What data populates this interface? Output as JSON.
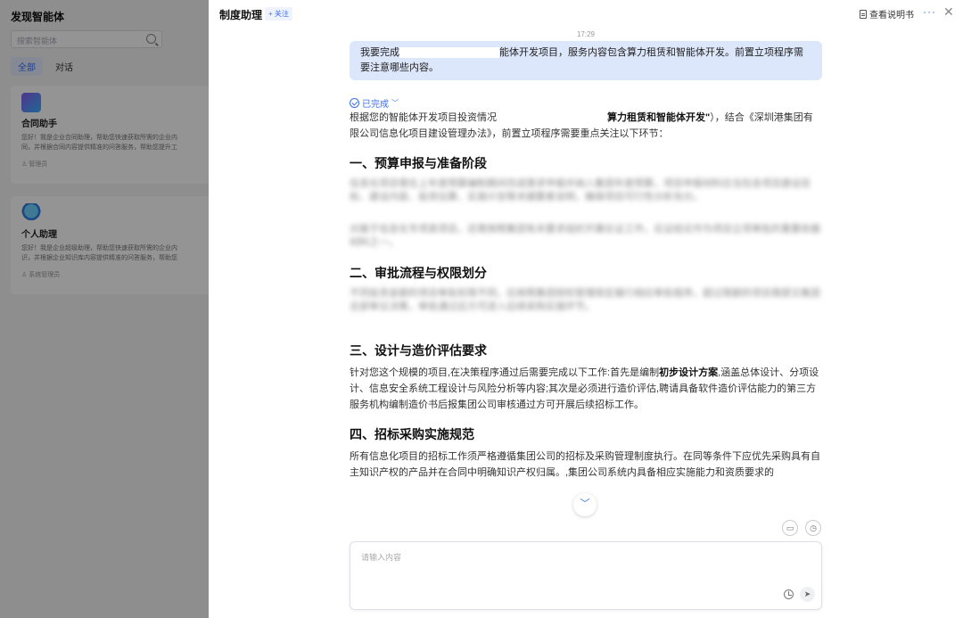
{
  "left_panel": {
    "title": "发现智能体",
    "search_placeholder": "搜索智能体",
    "tabs": [
      {
        "label": "全部",
        "active": true
      },
      {
        "label": "对话",
        "active": false
      }
    ],
    "cards": [
      {
        "name": "合同助手",
        "desc1": "您好！我是企业合同助理，帮助您快速获取所需的企业内",
        "desc2": "同，并根据合同内容提供精准的问答服务，帮助您提升工",
        "owner": "管理员"
      },
      {
        "name": "个人助理",
        "desc1": "您好！我是企业超级助理，帮助您快速获取所需的企业内",
        "desc2": "识，并根据企业知识库内容提供精准的问答服务，帮助您",
        "owner": "系统管理员"
      }
    ]
  },
  "header": {
    "title": "制度助理",
    "follow_label": "+ 关注",
    "manual_label": "查看说明书",
    "more_label": "···",
    "close_label": "✕"
  },
  "chat": {
    "timestamp": "17:29",
    "user_message_part1": "我要完成",
    "user_message_part2": "能体开发项目，服务内容包含算力租赁和智能体开发。前置立项程序需要注意哪些内容。",
    "status_label": "已完成",
    "answer_intro_part1": "根据您的智能体开发项目投资情况",
    "answer_intro_bold": "算力租赁和智能体开发\"",
    "answer_intro_part2": "），结合《深圳港集团有限公司信息化项目建设管理办法》，前置立项程序需要重点关注以下环节：",
    "sections": [
      {
        "title": "一、预算申报与准备阶段",
        "blur1": "信息化项目需在上年度预算编制期间完成需求申报并纳入集团年度预算，项目申报材料应当包含项目建设目标、建设内容、投资估算、实施计划等关键要素说明，确保项目可行性分析充分。",
        "blur2": "对属于信息化专项类项目，还需按照集团有关要求组织开展论证工作，论证结论作为项目立项审批的重要依据材料之一。"
      },
      {
        "title": "二、审批流程与权限划分",
        "blur1": "不同投资金额的项目审批权限不同，应按照集团授权管理规定履行相应审批程序，超过限额的项目需提交集团总部审议决策，审批通过后方可进入后续采购实施环节。"
      }
    ],
    "section3_title": "三、设计与造价评估要求",
    "section3_p1": "针对您这个规模的项目,在决策程序通过后需要完成以下工作:首先是编制",
    "section3_bold": "初步设计方案",
    "section3_p2": ",涵盖总体设计、分项设计、信息安全系统工程设计与风险分析等内容;其次是必须进行造价评估,聘请具备软件造价评估能力的第三方服务机构编制造价书后报集团公司审核通过方可开展后续招标工作。",
    "section4_title": "四、招标采购实施规范",
    "section4_p": "所有信息化项目的招标工作须严格遵循集团公司的招标及采购管理制度执行。在同等条件下应优先采购具有自主知识产权的产品并在合同中明确知识产权归属。,集团公司系统内具备相应实施能力和资质要求的"
  },
  "input": {
    "placeholder": "请输入内容"
  },
  "colors": {
    "accent": "#3a6ef5",
    "user_bubble": "#dde7fb"
  }
}
